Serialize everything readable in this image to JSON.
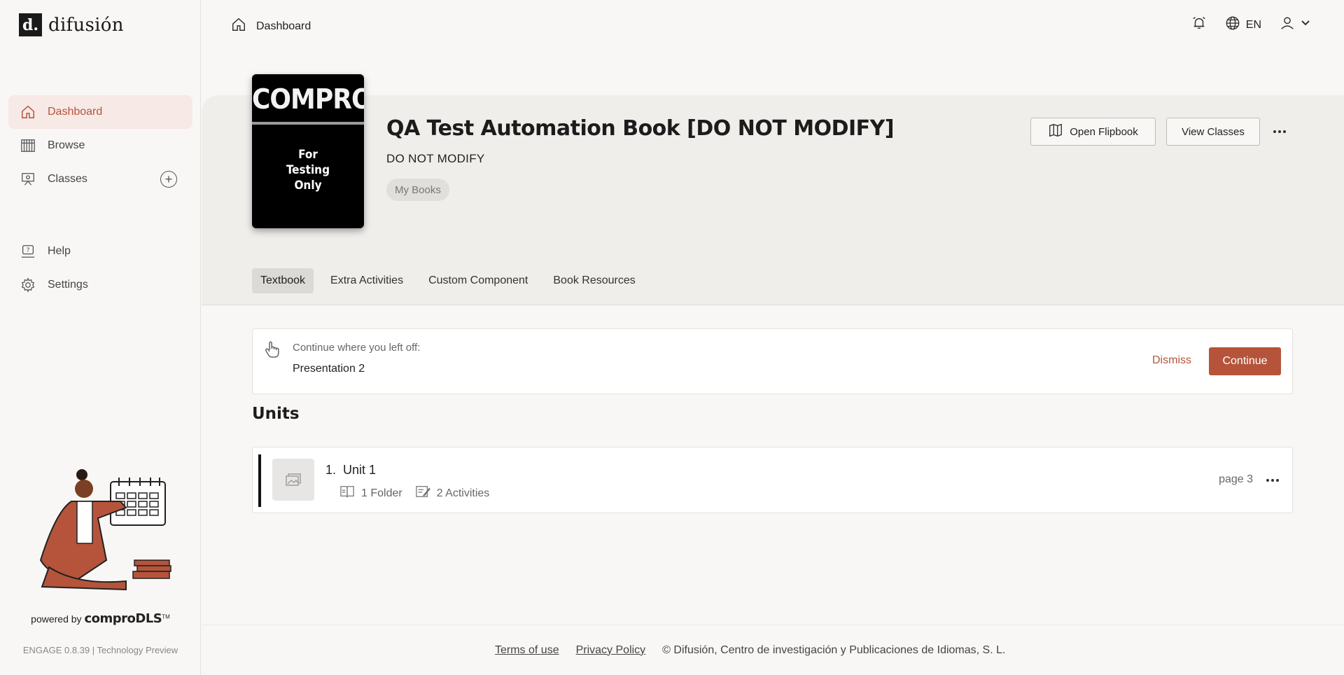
{
  "brand": {
    "logo_text": "difusión",
    "logo_mark": "d."
  },
  "sidebar": {
    "items": [
      {
        "label": "Dashboard",
        "icon": "home-icon",
        "active": true
      },
      {
        "label": "Browse",
        "icon": "bookshelf-icon"
      },
      {
        "label": "Classes",
        "icon": "classroom-icon"
      },
      {
        "label": "Help",
        "icon": "help-icon"
      },
      {
        "label": "Settings",
        "icon": "gear-icon"
      }
    ],
    "powered_by": "powered by",
    "powered_brand": "comproDLS",
    "powered_tm": "TM",
    "version": "ENGAGE 0.8.39 | Technology Preview"
  },
  "header": {
    "breadcrumb": "Dashboard",
    "language": "EN"
  },
  "book": {
    "cover_title": "COMPRO",
    "cover_subtitle": "For\nTesting\nOnly",
    "title": "QA Test Automation Book [DO NOT MODIFY]",
    "subtitle": "DO NOT MODIFY",
    "chip": "My Books",
    "open_flipbook": "Open Flipbook",
    "view_classes": "View Classes"
  },
  "tabs": [
    "Textbook",
    "Extra Activities",
    "Custom Component",
    "Book Resources"
  ],
  "continue_card": {
    "label": "Continue where you left off:",
    "value": "Presentation 2",
    "dismiss": "Dismiss",
    "continue": "Continue"
  },
  "units": {
    "heading": "Units",
    "items": [
      {
        "number": "1.",
        "title": "Unit 1",
        "folders": "1 Folder",
        "activities": "2 Activities",
        "page": "page 3"
      }
    ]
  },
  "footer": {
    "terms": "Terms of use",
    "privacy": "Privacy Policy",
    "copyright": "© Difusión, Centro de investigación y Publicaciones de Idiomas, S. L."
  },
  "colors": {
    "accent": "#b5543a",
    "accent_bg": "#f7e9e5",
    "background": "#f8f7f5",
    "hero_bg": "#efeeeb"
  }
}
